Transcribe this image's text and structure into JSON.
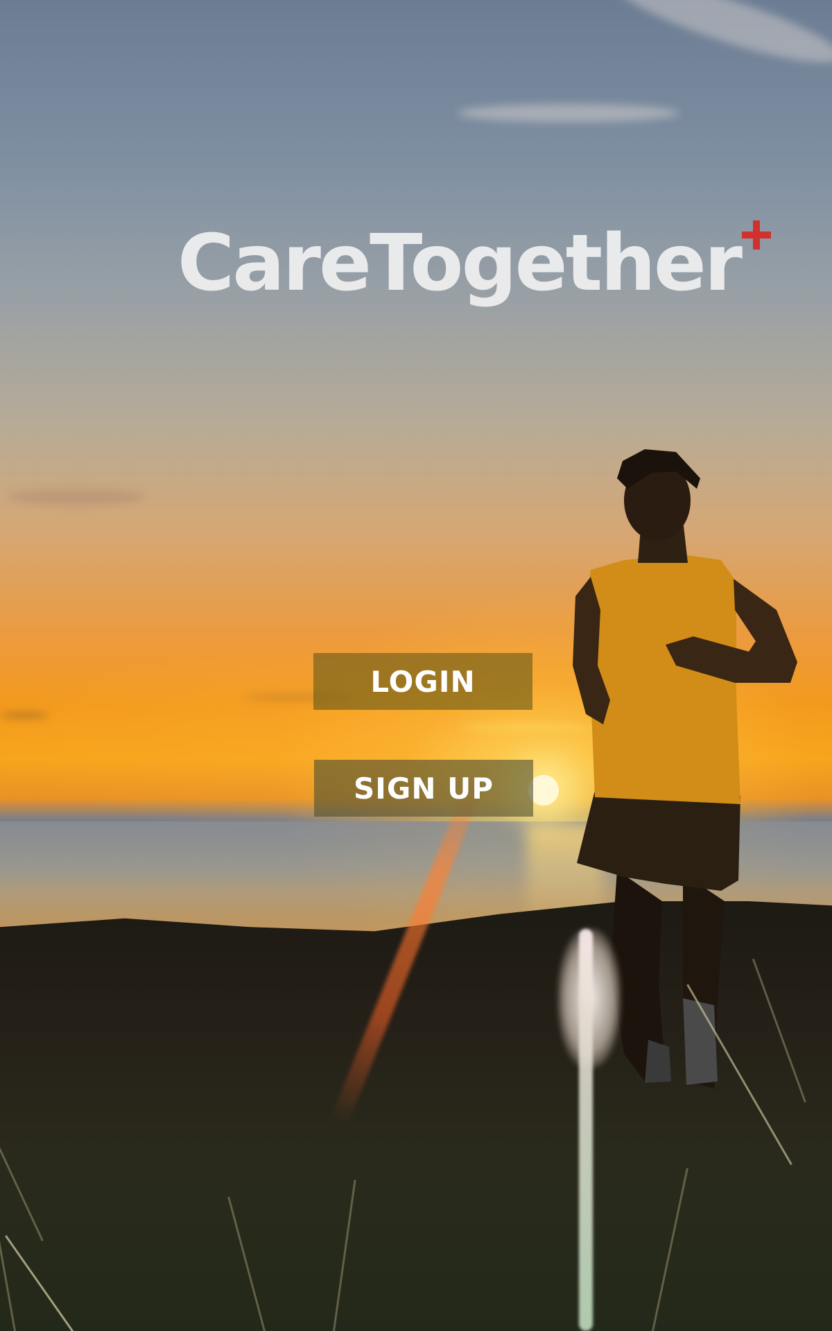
{
  "app": {
    "brand": {
      "name": "CareTogether",
      "accent_color": "#d0302e",
      "mark_icon": "plus-icon"
    }
  },
  "auth": {
    "login_label": "LOGIN",
    "signup_label": "SIGN UP"
  },
  "background": {
    "scene": "sunset-runner-photo"
  }
}
